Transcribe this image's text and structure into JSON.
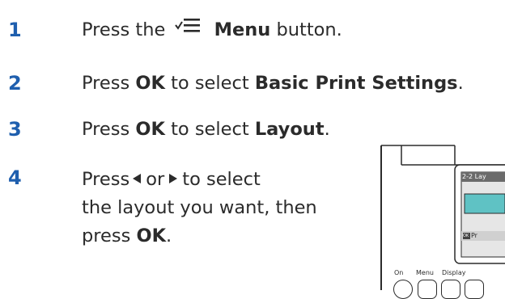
{
  "steps": [
    {
      "number": "1",
      "parts": [
        "Press the",
        "Menu",
        "button."
      ]
    },
    {
      "number": "2",
      "parts": [
        "Press",
        "OK",
        "to select",
        "Basic Print Settings",
        "."
      ]
    },
    {
      "number": "3",
      "parts": [
        "Press",
        "OK",
        "to select",
        "Layout",
        "."
      ]
    },
    {
      "number": "4",
      "line1": [
        "Press",
        "or",
        "to select"
      ],
      "line2": "the layout you want, then",
      "line3": [
        "press",
        "OK",
        "."
      ]
    }
  ],
  "printer": {
    "screen_header": "2-2 Lay",
    "screen_footer_badge": "OK",
    "screen_footer_text": "Pr",
    "button_labels": [
      "On",
      "Menu",
      "Display"
    ]
  },
  "colors": {
    "step_number": "#1f5fae",
    "screen_teal": "#5fc2c4"
  }
}
